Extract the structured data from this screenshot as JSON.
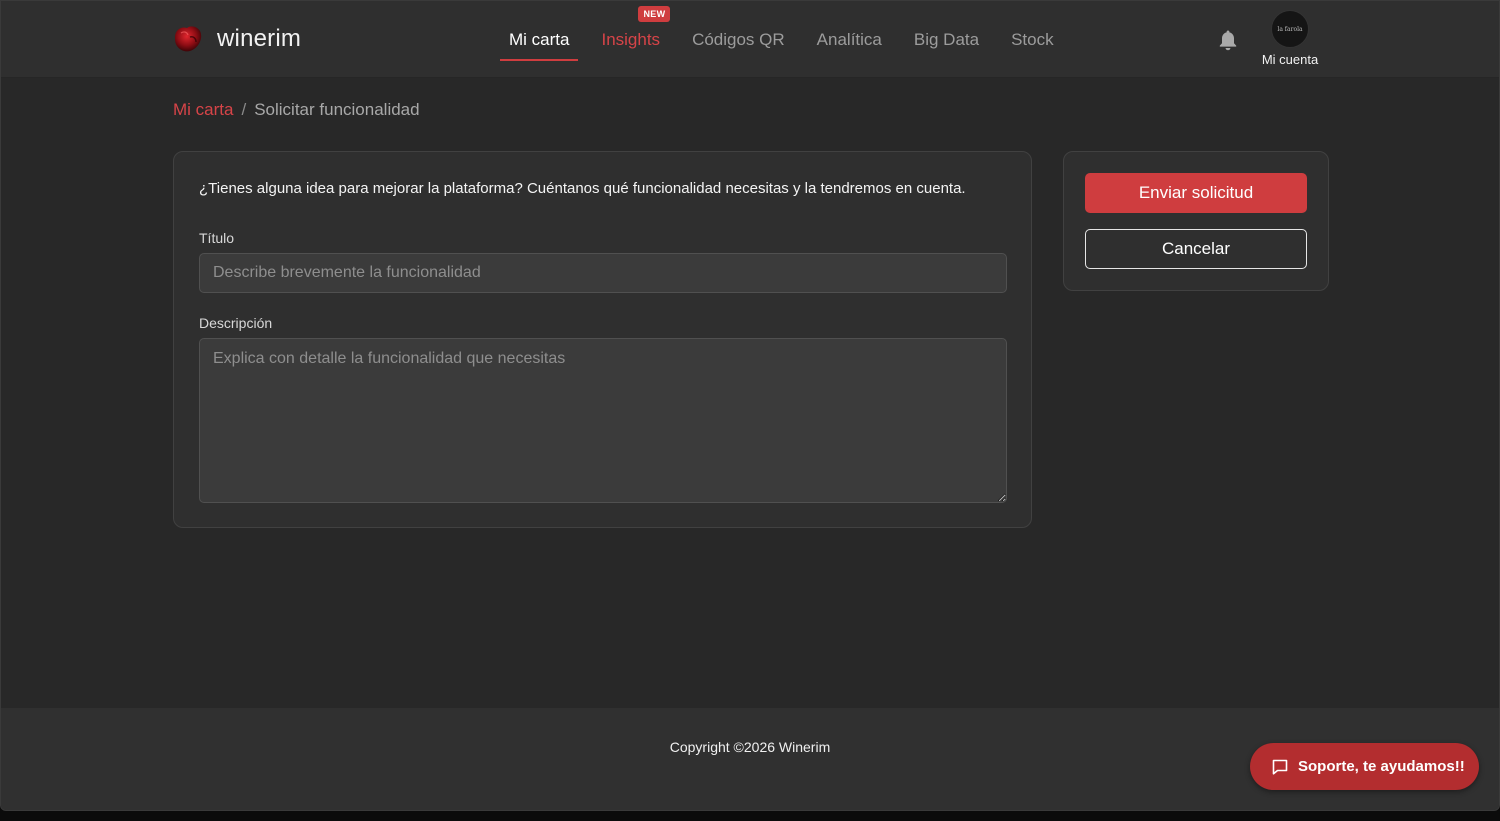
{
  "brand": {
    "name": "winerim",
    "accent_color": "#cf3d3f"
  },
  "nav": {
    "items": [
      {
        "label": "Mi carta",
        "state": "active"
      },
      {
        "label": "Insights",
        "badge": "NEW",
        "state": "highlight"
      },
      {
        "label": "Códigos QR"
      },
      {
        "label": "Analítica"
      },
      {
        "label": "Big Data"
      },
      {
        "label": "Stock"
      }
    ]
  },
  "account": {
    "label": "Mi cuenta",
    "avatar_text": "la farola",
    "notification_icon": "bell-icon"
  },
  "breadcrumb": {
    "parent": "Mi carta",
    "separator": "/",
    "current": "Solicitar funcionalidad"
  },
  "form": {
    "intro": "¿Tienes alguna idea para mejorar la plataforma? Cuéntanos qué funcionalidad necesitas y la tendremos en cuenta.",
    "title_label": "Título",
    "title_value": "",
    "title_placeholder": "Describe brevemente la funcionalidad",
    "description_label": "Descripción",
    "description_value": "",
    "description_placeholder": "Explica con detalle la funcionalidad que necesitas"
  },
  "actions": {
    "submit_label": "Enviar solicitud",
    "cancel_label": "Cancelar"
  },
  "footer": {
    "copyright": "Copyright ©2026 Winerim"
  },
  "support": {
    "label": "Soporte, te ayudamos!!",
    "icon": "chat-bubble-icon"
  }
}
